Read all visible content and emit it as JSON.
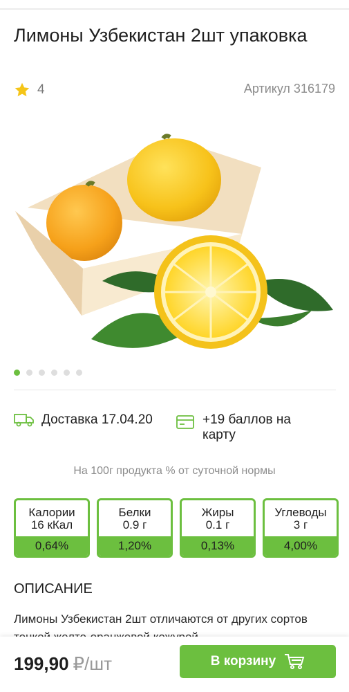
{
  "product": {
    "title": "Лимоны Узбекистан 2шт упаковка",
    "rating": "4",
    "sku": "Артикул 316179",
    "image_alt_icon": "lemons-in-wooden-box-image"
  },
  "gallery": {
    "count": 6,
    "active": 0
  },
  "delivery": {
    "text": "Доставка 17.04.20",
    "icon": "truck-icon"
  },
  "bonus": {
    "text": "+19 баллов на карту",
    "icon": "card-icon"
  },
  "nutrition": {
    "note": "На 100г продукта % от суточной нормы",
    "items": [
      {
        "name": "Калории",
        "value": "16 кКал",
        "percent": "0,64%"
      },
      {
        "name": "Белки",
        "value": "0.9 г",
        "percent": "1,20%"
      },
      {
        "name": "Жиры",
        "value": "0.1 г",
        "percent": "0,13%"
      },
      {
        "name": "Углеводы",
        "value": "3 г",
        "percent": "4,00%"
      }
    ]
  },
  "description": {
    "heading": "ОПИСАНИЕ",
    "text": "Лимоны Узбекистан 2шт отличаются от других сортов тонкой желто-оранжевой кожурой"
  },
  "bottom": {
    "price": "199,90",
    "unit": "₽/шт",
    "cart_label": "В корзину"
  },
  "colors": {
    "accent": "#6cbf3f",
    "star": "#f5c518"
  }
}
